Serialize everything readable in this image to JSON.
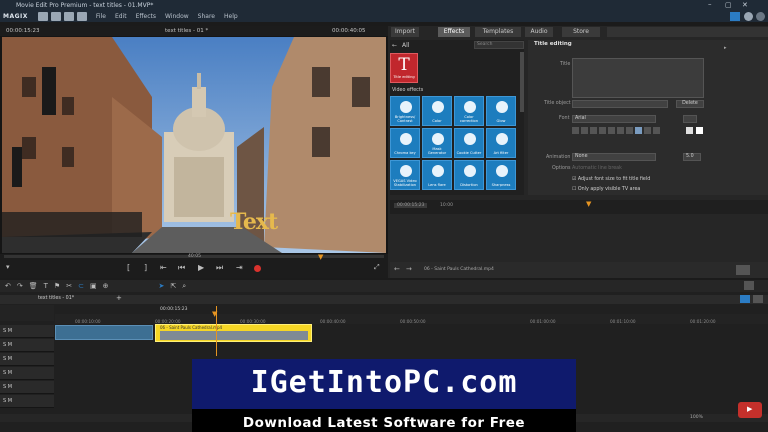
{
  "titlebar": {
    "logo": "MAGIX",
    "title": "Movie Edit Pro Premium - text titles - 01.MVP*",
    "menus": [
      "File",
      "Edit",
      "Effects",
      "Window",
      "Share",
      "Help"
    ]
  },
  "preview": {
    "timecode_left": "00:00:15:23",
    "title": "text titles - 01 *",
    "timecode_right": "00:00:40:05",
    "overlay_text": "Text",
    "scrub_time": "40:05"
  },
  "panel_tabs": [
    "Import",
    "Effects",
    "Templates",
    "Audio",
    "Store"
  ],
  "effects": {
    "filter_label": "All",
    "search_placeholder": "Search",
    "title_tile": {
      "glyph": "T",
      "label": "Title editing"
    },
    "section": "Video effects",
    "tiles": [
      "Brightness/\nContrast",
      "Color",
      "Color\ncorrection",
      "Glow",
      "Chroma key",
      "Mask\nGenerator",
      "Cookie Cutter",
      "Art filter",
      "VEGAS Video\nStabilization",
      "Lens flare",
      "Distortion",
      "Sharpness"
    ]
  },
  "title_editing": {
    "header": "Title editing",
    "title_label": "Title",
    "title_object_label": "Title object",
    "delete_label": "Delete",
    "font_label": "Font",
    "font_value": "Arial",
    "animation_label": "Animation",
    "animation_value": "None",
    "animation_num": "5.0",
    "options_label": "Options",
    "opt1": "Automatic line break",
    "opt2": "Adjust font size to fit title field",
    "opt3": "Only apply visible TV area"
  },
  "panel_footer": {
    "time_a": "00:00:15:23",
    "time_b": "10:00",
    "path": "06 - Saint Pauls Cathedral.mp4"
  },
  "timeline": {
    "tab": "text titles - 01*",
    "time": "00:00:15:23",
    "ruler": [
      "00:00:10:00",
      "00:00:20:00",
      "00:00:30:00",
      "00:00:40:00",
      "00:00:50:00",
      "00:01:00:00",
      "00:01:10:00",
      "00:01:20:00"
    ],
    "clip_label": "06 - Saint Pauls Cathedral.mp4",
    "zoom": "100%"
  },
  "banner": {
    "brand": "IGetIntoPC.com",
    "tagline": "Download Latest Software for Free"
  },
  "colors": {
    "accent_blue": "#1d7dbe",
    "clip_yellow": "#f5d625",
    "banner_navy": "#0f1a6d",
    "record_red": "#d9322d"
  }
}
